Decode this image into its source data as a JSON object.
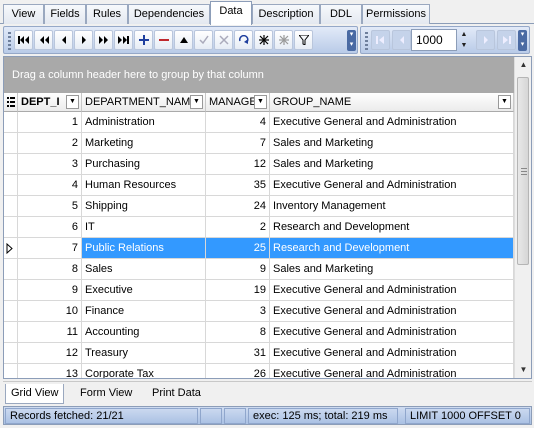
{
  "tabs": [
    {
      "label": "View",
      "active": false
    },
    {
      "label": "Fields",
      "active": false
    },
    {
      "label": "Rules",
      "active": false
    },
    {
      "label": "Dependencies",
      "active": false
    },
    {
      "label": "Data",
      "active": true
    },
    {
      "label": "Description",
      "active": false
    },
    {
      "label": "DDL",
      "active": false
    },
    {
      "label": "Permissions",
      "active": false
    }
  ],
  "toolbar": {
    "buttons": [
      "first-page-icon",
      "prior-page-icon",
      "prior-record-icon",
      "next-record-icon",
      "next-page-icon",
      "last-page-icon",
      "insert-icon",
      "delete-icon",
      "edit-icon",
      "post-icon",
      "cancel-icon",
      "refresh-icon",
      "bookmark-icon",
      "clear-bookmarks-icon",
      "filter-icon"
    ],
    "limit_value": "1000"
  },
  "grid": {
    "group_hint": "Drag a column header here to group by that column",
    "columns": [
      "DEPT_I",
      "DEPARTMENT_NAM",
      "MANAGE",
      "GROUP_NAME"
    ],
    "selected_row_index": 6,
    "rows": [
      {
        "id": "1",
        "name": "Administration",
        "manager": "4",
        "group": "Executive General and Administration"
      },
      {
        "id": "2",
        "name": "Marketing",
        "manager": "7",
        "group": "Sales and Marketing"
      },
      {
        "id": "3",
        "name": "Purchasing",
        "manager": "12",
        "group": "Sales and Marketing"
      },
      {
        "id": "4",
        "name": "Human Resources",
        "manager": "35",
        "group": "Executive General and Administration"
      },
      {
        "id": "5",
        "name": "Shipping",
        "manager": "24",
        "group": "Inventory Management"
      },
      {
        "id": "6",
        "name": "IT",
        "manager": "2",
        "group": "Research and Development"
      },
      {
        "id": "7",
        "name": "Public Relations",
        "manager": "25",
        "group": "Research and Development"
      },
      {
        "id": "8",
        "name": "Sales",
        "manager": "9",
        "group": "Sales and Marketing"
      },
      {
        "id": "9",
        "name": "Executive",
        "manager": "19",
        "group": "Executive General and Administration"
      },
      {
        "id": "10",
        "name": "Finance",
        "manager": "3",
        "group": "Executive General and Administration"
      },
      {
        "id": "11",
        "name": "Accounting",
        "manager": "8",
        "group": "Executive General and Administration"
      },
      {
        "id": "12",
        "name": "Treasury",
        "manager": "31",
        "group": "Executive General and Administration"
      },
      {
        "id": "13",
        "name": "Corporate Tax",
        "manager": "26",
        "group": "Executive General and Administration"
      }
    ]
  },
  "bottom_tabs": [
    {
      "label": "Grid View",
      "active": true
    },
    {
      "label": "Form View",
      "active": false
    },
    {
      "label": "Print Data",
      "active": false
    }
  ],
  "status": {
    "records": "Records fetched: 21/21",
    "exec": "exec: 125 ms; total: 219 ms",
    "limit": "LIMIT 1000 OFFSET 0"
  },
  "colors": {
    "selection": "#3399ff",
    "group_box": "#a9a9a9",
    "toolbar_gradient_top": "#e2eaf8",
    "toolbar_gradient_bottom": "#b9cbe8"
  }
}
